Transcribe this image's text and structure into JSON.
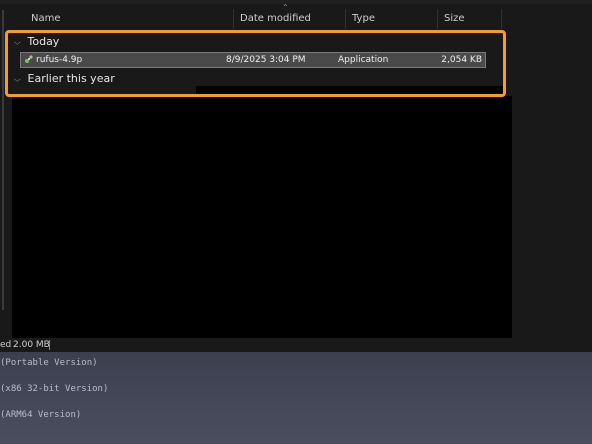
{
  "header": {
    "name": "Name",
    "date_modified": "Date modified",
    "type": "Type",
    "size": "Size"
  },
  "groups": {
    "today": "Today",
    "earlier": "Earlier this year"
  },
  "file": {
    "name": "rufus-4.9p",
    "date": "8/9/2025 3:04 PM",
    "type": "Application",
    "size": "2,054 KB",
    "icon": "rufus-app-icon"
  },
  "status": {
    "text": "ed",
    "size": "2.00 MB"
  },
  "bottom": {
    "line1": "(Portable Version)",
    "line2": "(x86 32-bit Version)",
    "line3": "(ARM64 Version)"
  },
  "colors": {
    "highlight": "#f59c2d",
    "background": "#191919",
    "panel": "#3b3f4e"
  }
}
